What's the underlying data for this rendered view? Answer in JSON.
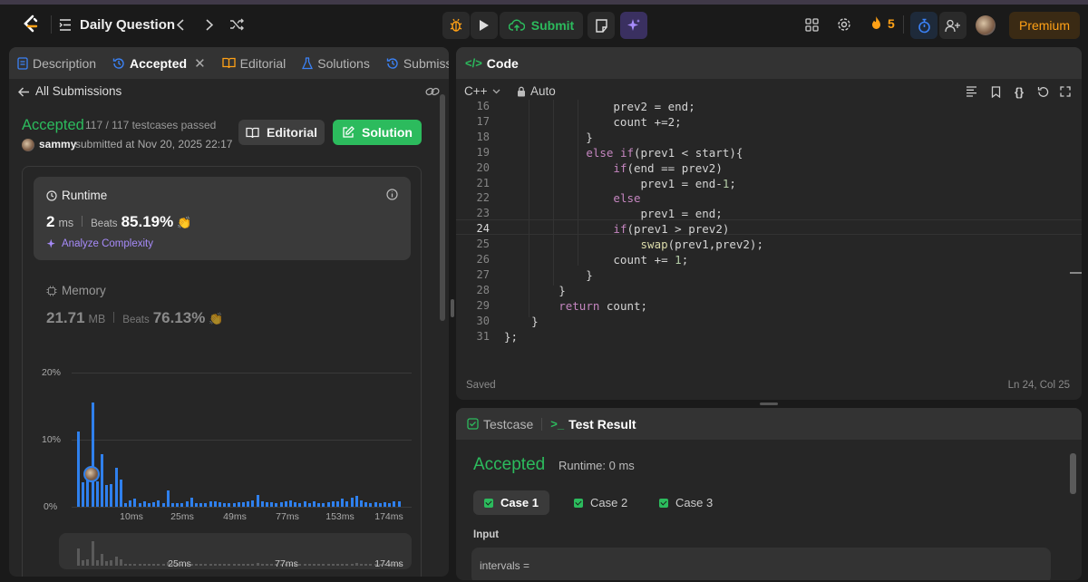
{
  "nav": {
    "title": "Daily Question",
    "submit": "Submit",
    "streak": "5",
    "premium": "Premium"
  },
  "left_tabs": [
    "Description",
    "Accepted",
    "Editorial",
    "Solutions",
    "Submissio"
  ],
  "submission": {
    "back": "All Submissions",
    "status": "Accepted",
    "testcases": "117 / 117 testcases passed",
    "user": "sammy",
    "submitted": "submitted at Nov 20, 2025 22:17",
    "editorial_btn": "Editorial",
    "solution_btn": "Solution",
    "runtime_label": "Runtime",
    "runtime_value": "2",
    "runtime_unit": "ms",
    "beats": "Beats",
    "runtime_beats": "85.19%",
    "analyze": "Analyze Complexity",
    "memory_label": "Memory",
    "memory_value": "21.71",
    "memory_unit": "MB",
    "memory_beats": "76.13%"
  },
  "chart_data": {
    "type": "bar",
    "ylim": [
      0,
      20
    ],
    "yticks": [
      "20%",
      "10%",
      "0%"
    ],
    "xticks": [
      "10ms",
      "25ms",
      "49ms",
      "77ms",
      "153ms",
      "174ms"
    ],
    "values": [
      11.2,
      3.6,
      4.0,
      15.6,
      3.8,
      7.8,
      3.2,
      3.4,
      5.8,
      4.0,
      0.6,
      0.9,
      1.2,
      0.6,
      0.8,
      0.5,
      0.7,
      0.9,
      0.6,
      2.4,
      0.6,
      0.6,
      0.6,
      0.8,
      1.3,
      0.5,
      0.6,
      0.6,
      0.8,
      0.8,
      0.7,
      0.6,
      0.6,
      0.6,
      0.7,
      0.7,
      0.8,
      0.9,
      1.7,
      0.8,
      0.7,
      0.7,
      0.6,
      0.7,
      0.8,
      0.9,
      0.7,
      0.6,
      0.8,
      0.6,
      0.8,
      0.6,
      0.6,
      0.7,
      0.8,
      0.8,
      1.2,
      0.8,
      1.4,
      1.6,
      1.0,
      0.7,
      0.6,
      0.7,
      0.6,
      0.7,
      0.6,
      0.8,
      0.8
    ],
    "highlight_index": 5,
    "mini_xticks": [
      "25ms",
      "77ms",
      "174ms"
    ]
  },
  "code": {
    "title": "Code",
    "language": "C++",
    "mode": "Auto",
    "saved": "Saved",
    "cursor": "Ln 24, Col 25",
    "lines": [
      {
        "n": "16",
        "html": "                prev2 = end;"
      },
      {
        "n": "17",
        "html": "                count +=2;"
      },
      {
        "n": "18",
        "html": "            }"
      },
      {
        "n": "19",
        "html": "            <span class='kw'>else if</span>(prev1 &lt; start){"
      },
      {
        "n": "20",
        "html": "                <span class='kw'>if</span>(end == prev2)"
      },
      {
        "n": "21",
        "html": "                    prev1 = end-<span class='num'>1</span>;"
      },
      {
        "n": "22",
        "html": "                <span class='kw'>else</span>"
      },
      {
        "n": "23",
        "html": "                    prev1 = end;"
      },
      {
        "n": "24",
        "html": "                <span class='kw'>if</span>(prev1 &gt; prev2)"
      },
      {
        "n": "25",
        "html": "                    <span class='fn'>swap</span>(prev1,prev2);"
      },
      {
        "n": "26",
        "html": "                count += <span class='num'>1</span>;"
      },
      {
        "n": "27",
        "html": "            }"
      },
      {
        "n": "28",
        "html": "        }"
      },
      {
        "n": "29",
        "html": "        <span class='kw'>return</span> count;"
      },
      {
        "n": "30",
        "html": "    }"
      },
      {
        "n": "31",
        "html": "};"
      }
    ]
  },
  "test": {
    "testcase_tab": "Testcase",
    "result_tab": "Test Result",
    "status": "Accepted",
    "runtime": "Runtime: 0 ms",
    "cases": [
      "Case 1",
      "Case 2",
      "Case 3"
    ],
    "input_label": "Input",
    "input_value": "intervals ="
  },
  "colors": {
    "accent": "#2cbb5d",
    "bar": "#2f80ed",
    "streak": "#ffa116"
  }
}
